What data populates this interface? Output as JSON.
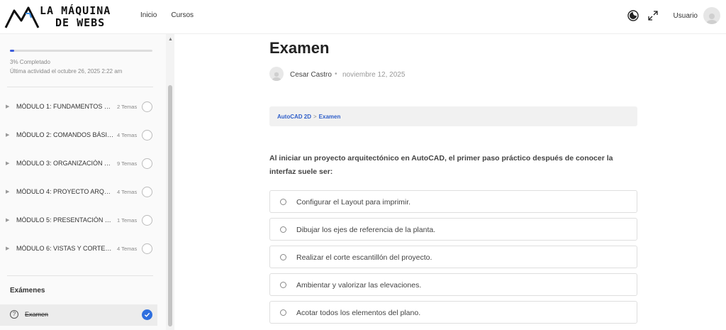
{
  "header": {
    "logo_line1": "LA MÁQUINA",
    "logo_line2": "DE WEBS",
    "nav": [
      "Inicio",
      "Cursos"
    ],
    "user_label": "Usuario",
    "icons": [
      "moon-icon",
      "expand-icon",
      "avatar-icon"
    ]
  },
  "sidebar": {
    "progress_percent": 3,
    "progress_label": "3% Completado",
    "activity_label": "Última actividad el octubre 26, 2025 2:22 am",
    "modules": [
      {
        "title": "MÓDULO 1: FUNDAMENTOS E I...",
        "count": "2 Temas"
      },
      {
        "title": "MÓDULO 2: COMANDOS BÁSIC...",
        "count": "4 Temas"
      },
      {
        "title": "MÓDULO 3: ORGANIZACIÓN Y ...",
        "count": "9 Temas"
      },
      {
        "title": "MÓDULO 4: PROYECTO ARQUIT...",
        "count": "4 Temas"
      },
      {
        "title": "MÓDULO 5: PRESENTACIÓN Y ...",
        "count": "1 Temas"
      },
      {
        "title": "MÓDULO 6: VISTAS Y CORTES D...",
        "count": "4 Temas"
      }
    ],
    "exams_title": "Exámenes",
    "exam_item": "Examen"
  },
  "main": {
    "title": "Examen",
    "author": "Cesar Castro",
    "dot": "•",
    "date": "noviembre 12, 2025",
    "breadcrumb": {
      "course": "AutoCAD 2D",
      "separator": ">",
      "current": "Examen"
    },
    "question": "Al iniciar un proyecto arquitectónico en AutoCAD, el primer paso práctico después de conocer la interfaz suele ser:",
    "options": [
      "Configurar el Layout para imprimir.",
      "Dibujar los ejes de referencia de la planta.",
      "Realizar el corte escantillón del proyecto.",
      "Ambientar y valorizar las elevaciones.",
      "Acotar todos los elementos del plano."
    ]
  },
  "colors": {
    "accent": "#2f6fdf",
    "progress": "#3b5bdb",
    "link": "#2f5fc9"
  }
}
